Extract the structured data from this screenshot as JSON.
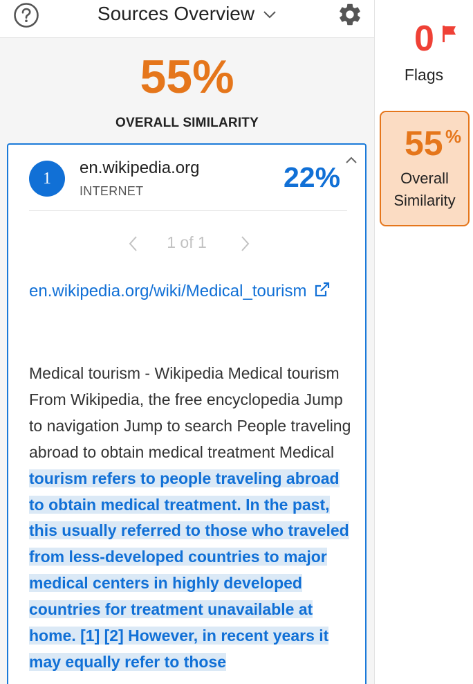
{
  "header": {
    "title": "Sources Overview",
    "help_icon": "help-circle-icon",
    "dropdown_icon": "chevron-down-icon",
    "settings_icon": "gear-icon"
  },
  "overall": {
    "percent": "55%",
    "label": "OVERALL SIMILARITY"
  },
  "source": {
    "number": "1",
    "domain": "en.wikipedia.org",
    "type": "INTERNET",
    "percent": "22%",
    "collapse_icon": "chevron-up-icon",
    "pager": {
      "text": "1 of 1",
      "prev_icon": "chevron-left-icon",
      "next_icon": "chevron-right-icon"
    },
    "url": "en.wikipedia.org/wiki/Medical_tourism",
    "external_icon": "external-link-icon",
    "text_plain": "Medical tourism - Wikipedia Medical tourism From Wikipedia, the free encyclopedia Jump to navigation Jump to search People traveling abroad to obtain medical treatment Medical ",
    "text_match": "tourism refers to people traveling abroad to obtain medical treatment. In the past, this usually referred to those who traveled from less-developed countries to major medical centers in highly developed countries for treatment unavailable at home. [1] [2] However, in recent years it may equally refer to those"
  },
  "right_panel": {
    "flags_count": "0",
    "flags_label": "Flags",
    "flag_icon": "flag-icon",
    "similarity_number": "55",
    "similarity_sign": "%",
    "similarity_label_line1": "Overall",
    "similarity_label_line2": "Similarity"
  },
  "colors": {
    "orange_accent": "#e5761b",
    "blue_accent": "#1170d6",
    "flag_red": "#ef4136",
    "match_highlight": "#dbe9f6",
    "similarity_box_bg": "#fbdcc3"
  }
}
